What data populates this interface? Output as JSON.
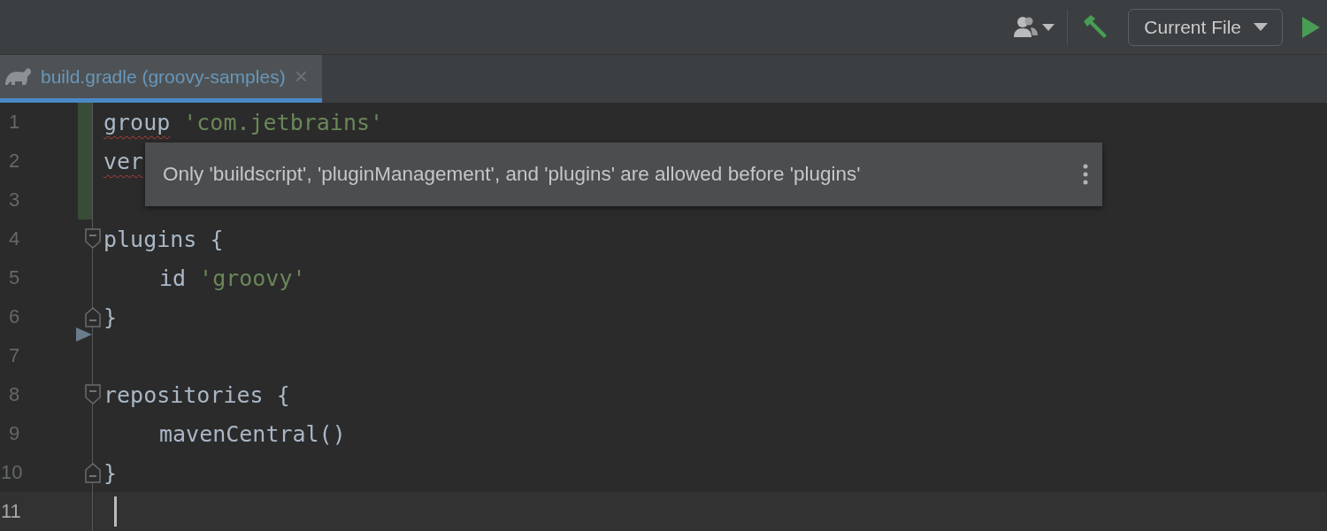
{
  "toolbar": {
    "run_config": "Current File"
  },
  "tabs": [
    {
      "label": "build.gradle (groovy-samples)",
      "selected": true,
      "close": "×"
    }
  ],
  "editor": {
    "lines": [
      {
        "number": "1",
        "kind": "code",
        "changed": true,
        "current": false,
        "indented": false,
        "tokens": [
          {
            "text": "group",
            "kind": "error"
          },
          {
            "text": "'com.jetbrains'",
            "kind": "string"
          }
        ]
      },
      {
        "number": "2",
        "kind": "code",
        "changed": true,
        "current": false,
        "indented": false,
        "tokens": [
          {
            "text": "ver",
            "kind": "error"
          }
        ]
      },
      {
        "number": "3",
        "kind": "code",
        "changed": true,
        "current": false
      },
      {
        "number": "4",
        "kind": "fold-start",
        "changed": false,
        "current": false,
        "indented": false,
        "tokens": [
          {
            "text": "plugins {",
            "kind": "plain"
          }
        ]
      },
      {
        "number": "5",
        "kind": "code",
        "changed": false,
        "current": false,
        "indented": true,
        "tokens": [
          {
            "text": "id",
            "kind": "plain"
          },
          {
            "text": "'groovy'",
            "kind": "string"
          }
        ]
      },
      {
        "number": "6",
        "kind": "fold-end",
        "changed": false,
        "current": false,
        "indented": false,
        "tokens": [
          {
            "text": "}",
            "kind": "plain"
          }
        ]
      },
      {
        "number": "7",
        "kind": "code",
        "changed": false,
        "current": false
      },
      {
        "number": "8",
        "kind": "fold-start",
        "changed": false,
        "current": false,
        "indented": false,
        "tokens": [
          {
            "text": "repositories {",
            "kind": "plain"
          }
        ]
      },
      {
        "number": "9",
        "kind": "code",
        "changed": false,
        "current": false,
        "indented": true,
        "tokens": [
          {
            "text": "mavenCentral()",
            "kind": "plain"
          }
        ]
      },
      {
        "number": "10",
        "kind": "fold-end",
        "changed": false,
        "current": false,
        "indented": false,
        "tokens": [
          {
            "text": "}",
            "kind": "plain"
          }
        ]
      },
      {
        "number": "11",
        "kind": "code",
        "changed": false,
        "current": true
      }
    ]
  },
  "tooltip": {
    "message": "Only 'buildscript', 'pluginManagement', and 'plugins' are allowed before 'plugins'"
  }
}
